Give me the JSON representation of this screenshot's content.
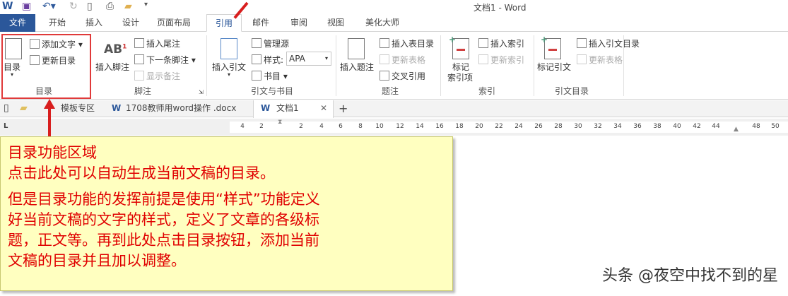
{
  "window_title": "文档1 - Word",
  "quick_access": [
    "word-app-icon",
    "save-icon",
    "undo-icon",
    "redo-icon",
    "new-doc-icon",
    "print-preview-icon",
    "open-folder-icon",
    "customize-icon"
  ],
  "tabs": [
    "文件",
    "开始",
    "插入",
    "设计",
    "页面布局",
    "引用",
    "邮件",
    "审阅",
    "视图",
    "美化大师"
  ],
  "active_tab": "引用",
  "ribbon": {
    "toc": {
      "big": "目录",
      "add_text": "添加文字",
      "update": "更新目录",
      "group": "目录"
    },
    "footnote": {
      "insert_footnote": "插入脚注",
      "insert_endnote": "插入尾注",
      "next_footnote": "下一条脚注",
      "show_notes": "显示备注",
      "group": "脚注"
    },
    "citation": {
      "insert_citation": "插入引文",
      "manage_sources": "管理源",
      "style_label": "样式:",
      "style_value": "APA",
      "bibliography": "书目",
      "group": "引文与书目"
    },
    "caption": {
      "insert_caption": "插入题注",
      "insert_table_of_figures": "插入表目录",
      "update_table": "更新表格",
      "cross_reference": "交叉引用",
      "group": "题注"
    },
    "index": {
      "mark_entry_1": "标记",
      "mark_entry_2": "索引项",
      "insert_index": "插入索引",
      "update_index": "更新索引",
      "group": "索引"
    },
    "toa": {
      "mark_citation": "标记引文",
      "insert_toa": "插入引文目录",
      "update_table": "更新表格",
      "group": "引文目录"
    }
  },
  "doc_tabs": [
    "模板专区",
    "1708教师用word操作 .docx",
    "文档1"
  ],
  "ruler_numbers": [
    "4",
    "2",
    "2",
    "4",
    "6",
    "8",
    "10",
    "12",
    "14",
    "16",
    "18",
    "20",
    "22",
    "24",
    "26",
    "28",
    "30",
    "32",
    "34",
    "36",
    "38",
    "40",
    "42",
    "44",
    "48",
    "50"
  ],
  "note": {
    "title": "目录功能区域",
    "line1": "点击此处可以自动生成当前文稿的目录。",
    "para": [
      "但是目录功能的发挥前提是使用“样式”功能定义",
      "好当前文稿的文字的样式，定义了文章的各级标",
      "题，正文等。再到此处点击目录按钮，添加当前",
      "文稿的目录并且加以调整。"
    ]
  },
  "watermark": "头条 @夜空中找不到的星"
}
